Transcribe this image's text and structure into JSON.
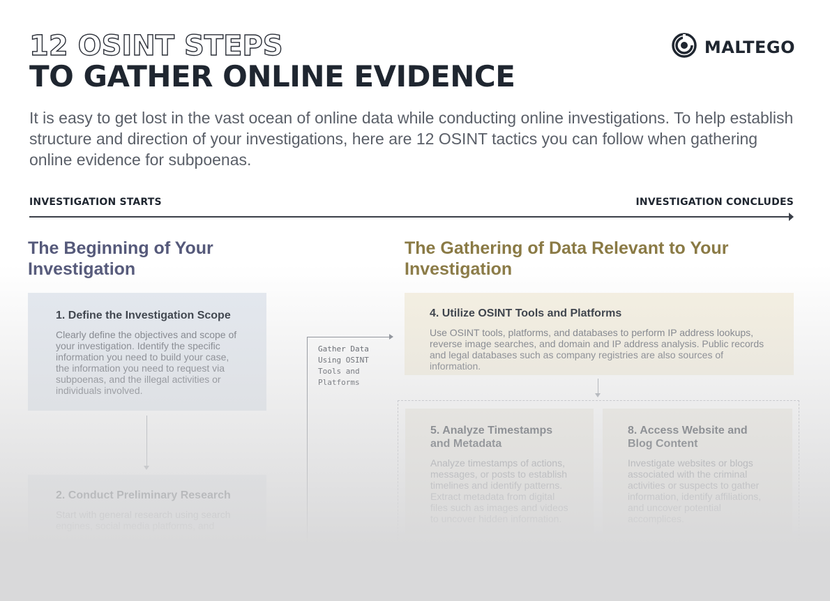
{
  "header": {
    "title_line1": "12 OSINT STEPS",
    "title_line2": "TO GATHER ONLINE EVIDENCE",
    "logo_text": "MALTEGO",
    "logo_icon": "maltego-logo-icon"
  },
  "intro": "It is easy to get lost in the vast ocean of online data while conducting online investigations. To help establish structure and direction of your investigations, here are 12 OSINT tactics you can follow when gathering online evidence for subpoenas.",
  "timeline": {
    "start_label": "INVESTIGATION STARTS",
    "end_label": "INVESTIGATION CONCLUDES"
  },
  "sections": {
    "left_heading": "The Beginning of Your Investigation",
    "right_heading": "The Gathering of Data Relevant to Your Investigation"
  },
  "side_note": "Gather Data Using OSINT Tools and Platforms",
  "steps": [
    {
      "title": "1. Define the Investigation Scope",
      "text": "Clearly define the objectives and scope of your investigation. Identify the specific information you need to build your case, the information you need to request via subpoenas, and the illegal activities or individuals involved."
    },
    {
      "title": "2. Conduct Preliminary Research",
      "text": "Start with general research using search engines, social media platforms, and"
    },
    {
      "title": "4. Utilize OSINT Tools and Platforms",
      "text": "Use OSINT tools, platforms, and databases to perform IP address lookups, reverse image searches, and domain and IP address analysis. Public records and legal databases such as company registries are also sources of information."
    },
    {
      "title": "5. Analyze Timestamps and Metadata",
      "text": "Analyze timestamps of actions, messages, or posts to establish timelines and identify patterns. Extract metadata from digital files such as images and videos to uncover hidden information."
    },
    {
      "title": "8. Access Website and Blog Content",
      "text": "Investigate websites or blogs associated with the criminal activities or suspects to gather information, identify affiliations, and uncover potential accomplices."
    }
  ],
  "colors": {
    "left_accent": "#55597a",
    "right_accent": "#8a7a45",
    "left_card": "#e4e9f0",
    "right_card": "#f6f1e2"
  }
}
